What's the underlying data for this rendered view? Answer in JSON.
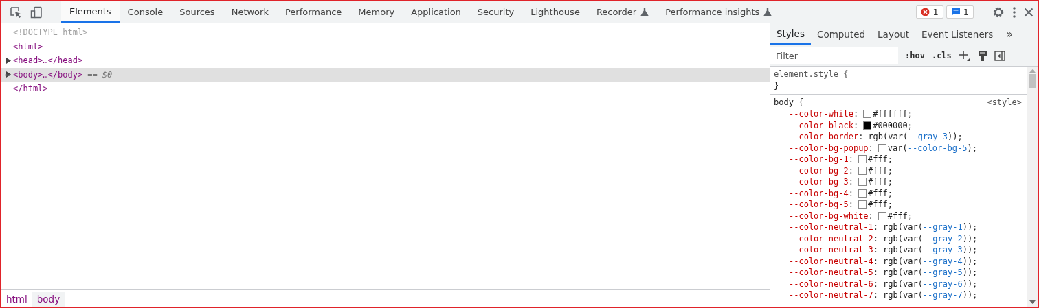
{
  "toolbar": {
    "tabs": [
      {
        "label": "Elements",
        "selected": true,
        "experimental": false
      },
      {
        "label": "Console",
        "selected": false,
        "experimental": false
      },
      {
        "label": "Sources",
        "selected": false,
        "experimental": false
      },
      {
        "label": "Network",
        "selected": false,
        "experimental": false
      },
      {
        "label": "Performance",
        "selected": false,
        "experimental": false
      },
      {
        "label": "Memory",
        "selected": false,
        "experimental": false
      },
      {
        "label": "Application",
        "selected": false,
        "experimental": false
      },
      {
        "label": "Security",
        "selected": false,
        "experimental": false
      },
      {
        "label": "Lighthouse",
        "selected": false,
        "experimental": false
      },
      {
        "label": "Recorder",
        "selected": false,
        "experimental": true
      },
      {
        "label": "Performance insights",
        "selected": false,
        "experimental": true
      }
    ],
    "errors": "1",
    "messages": "1"
  },
  "dom_tree": [
    {
      "kind": "comment",
      "text": "<!DOCTYPE html>",
      "selected": false
    },
    {
      "kind": "tag",
      "text": "<html>",
      "selected": false
    },
    {
      "kind": "collapsed",
      "text": "<head>…</head>",
      "selected": false
    },
    {
      "kind": "collapsed",
      "text": "<body>…</body>",
      "suffix": "== $0",
      "selected": true
    },
    {
      "kind": "tag",
      "text": "</html>",
      "selected": false
    }
  ],
  "breadcrumbs": [
    {
      "label": "html",
      "selected": false
    },
    {
      "label": "body",
      "selected": true
    }
  ],
  "sidebar": {
    "tabs": [
      {
        "label": "Styles",
        "selected": true
      },
      {
        "label": "Computed",
        "selected": false
      },
      {
        "label": "Layout",
        "selected": false
      },
      {
        "label": "Event Listeners",
        "selected": false
      }
    ],
    "more": "»",
    "filter": {
      "placeholder": "Filter"
    },
    "hov": ":hov",
    "cls": ".cls",
    "element_style": {
      "selector": "element.style {",
      "close": "}"
    },
    "rule": {
      "selector": "body {",
      "source": "<style>",
      "separator": ":",
      "declarations": [
        {
          "name": "--color-white",
          "color": "#ffffff",
          "value": [
            {
              "kind": "text",
              "text": "#ffffff;"
            }
          ]
        },
        {
          "name": "--color-black",
          "color": "#000000",
          "value": [
            {
              "kind": "text",
              "text": "#000000;"
            }
          ]
        },
        {
          "name": "--color-border",
          "value": [
            {
              "kind": "text",
              "text": "rgb(var("
            },
            {
              "kind": "ref",
              "text": "--gray-3"
            },
            {
              "kind": "text",
              "text": "));"
            }
          ]
        },
        {
          "name": "--color-bg-popup",
          "color": "#ffffff",
          "value": [
            {
              "kind": "text",
              "text": "var("
            },
            {
              "kind": "ref",
              "text": "--color-bg-5"
            },
            {
              "kind": "text",
              "text": ");"
            }
          ]
        },
        {
          "name": "--color-bg-1",
          "color": "#ffffff",
          "value": [
            {
              "kind": "text",
              "text": "#fff;"
            }
          ]
        },
        {
          "name": "--color-bg-2",
          "color": "#ffffff",
          "value": [
            {
              "kind": "text",
              "text": "#fff;"
            }
          ]
        },
        {
          "name": "--color-bg-3",
          "color": "#ffffff",
          "value": [
            {
              "kind": "text",
              "text": "#fff;"
            }
          ]
        },
        {
          "name": "--color-bg-4",
          "color": "#ffffff",
          "value": [
            {
              "kind": "text",
              "text": "#fff;"
            }
          ]
        },
        {
          "name": "--color-bg-5",
          "color": "#ffffff",
          "value": [
            {
              "kind": "text",
              "text": "#fff;"
            }
          ]
        },
        {
          "name": "--color-bg-white",
          "color": "#ffffff",
          "value": [
            {
              "kind": "text",
              "text": "#fff;"
            }
          ]
        },
        {
          "name": "--color-neutral-1",
          "value": [
            {
              "kind": "text",
              "text": "rgb(var("
            },
            {
              "kind": "ref",
              "text": "--gray-1"
            },
            {
              "kind": "text",
              "text": "));"
            }
          ]
        },
        {
          "name": "--color-neutral-2",
          "value": [
            {
              "kind": "text",
              "text": "rgb(var("
            },
            {
              "kind": "ref",
              "text": "--gray-2"
            },
            {
              "kind": "text",
              "text": "));"
            }
          ]
        },
        {
          "name": "--color-neutral-3",
          "value": [
            {
              "kind": "text",
              "text": "rgb(var("
            },
            {
              "kind": "ref",
              "text": "--gray-3"
            },
            {
              "kind": "text",
              "text": "));"
            }
          ]
        },
        {
          "name": "--color-neutral-4",
          "value": [
            {
              "kind": "text",
              "text": "rgb(var("
            },
            {
              "kind": "ref",
              "text": "--gray-4"
            },
            {
              "kind": "text",
              "text": "));"
            }
          ]
        },
        {
          "name": "--color-neutral-5",
          "value": [
            {
              "kind": "text",
              "text": "rgb(var("
            },
            {
              "kind": "ref",
              "text": "--gray-5"
            },
            {
              "kind": "text",
              "text": "));"
            }
          ]
        },
        {
          "name": "--color-neutral-6",
          "value": [
            {
              "kind": "text",
              "text": "rgb(var("
            },
            {
              "kind": "ref",
              "text": "--gray-6"
            },
            {
              "kind": "text",
              "text": "));"
            }
          ]
        },
        {
          "name": "--color-neutral-7",
          "value": [
            {
              "kind": "text",
              "text": "rgb(var("
            },
            {
              "kind": "ref",
              "text": "--gray-7"
            },
            {
              "kind": "text",
              "text": "));"
            }
          ]
        }
      ]
    }
  }
}
